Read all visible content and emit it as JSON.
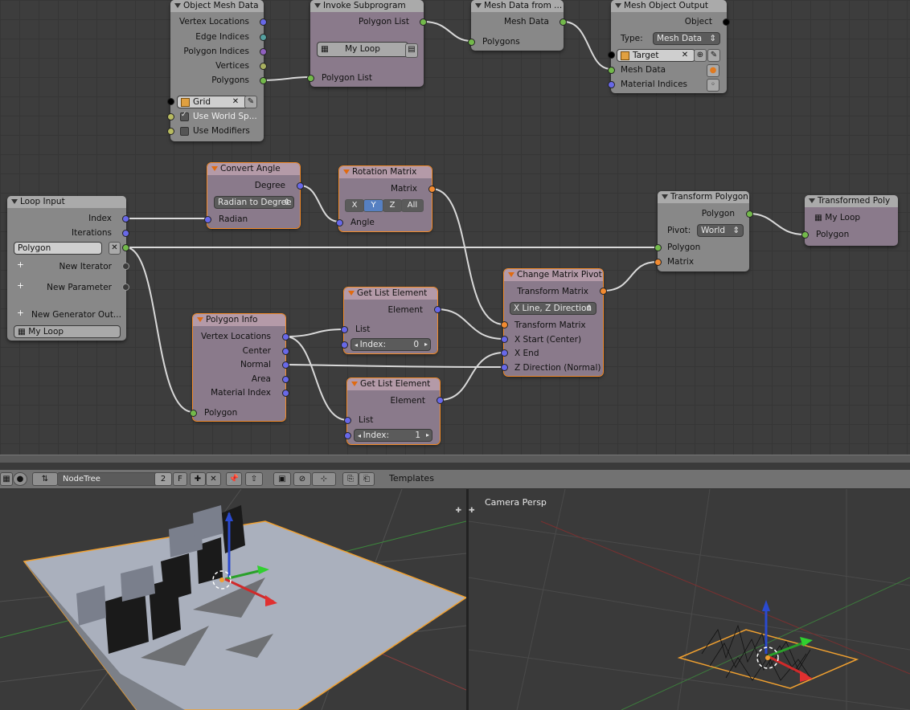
{
  "nodes": {
    "object_mesh_data": {
      "title": "Object Mesh Data",
      "outputs": [
        "Vertex Locations",
        "Edge Indices",
        "Polygon Indices",
        "Vertices",
        "Polygons"
      ],
      "object": "Grid",
      "use_world_space": "Use World Sp...",
      "use_modifiers": "Use Modifiers"
    },
    "invoke_subprogram": {
      "title": "Invoke Subprogram",
      "output": "Polygon List",
      "subprogram": "My Loop",
      "input": "Polygon List"
    },
    "mesh_data_from": {
      "title": "Mesh Data from ...",
      "output": "Mesh Data",
      "input": "Polygons"
    },
    "mesh_object_output": {
      "title": "Mesh Object Output",
      "output": "Object",
      "type_label": "Type:",
      "type_value": "Mesh Data",
      "target": "Target",
      "inputs": [
        "Mesh Data",
        "Material Indices"
      ]
    },
    "loop_input": {
      "title": "Loop Input",
      "outputs": [
        "Index",
        "Iterations"
      ],
      "polygon_param": "Polygon",
      "new_iterator": "New Iterator",
      "new_parameter": "New Parameter",
      "new_generator": "New Generator Out...",
      "loop_name": "My Loop"
    },
    "convert_angle": {
      "title": "Convert Angle",
      "output": "Degree",
      "mode": "Radian to Degree",
      "input": "Radian"
    },
    "rotation_matrix": {
      "title": "Rotation Matrix",
      "output": "Matrix",
      "axes": [
        "X",
        "Y",
        "Z",
        "All"
      ],
      "input": "Angle"
    },
    "transform_polygon": {
      "title": "Transform Polygon",
      "output": "Polygon",
      "pivot_label": "Pivot:",
      "pivot_value": "World",
      "inputs": [
        "Polygon",
        "Matrix"
      ]
    },
    "transformed_poly": {
      "title": "Transformed Poly",
      "loop_name": "My Loop",
      "input": "Polygon"
    },
    "change_matrix_pivot": {
      "title": "Change Matrix Pivot",
      "output": "Transform Matrix",
      "mode": "X Line, Z Direction",
      "inputs": [
        "Transform Matrix",
        "X Start (Center)",
        "X End",
        "Z Direction (Normal)"
      ]
    },
    "get_list_element_1": {
      "title": "Get List Element",
      "output": "Element",
      "input": "List",
      "index_label": "Index:",
      "index_value": "0"
    },
    "get_list_element_2": {
      "title": "Get List Element",
      "output": "Element",
      "input": "List",
      "index_label": "Index:",
      "index_value": "1"
    },
    "polygon_info": {
      "title": "Polygon Info",
      "outputs": [
        "Vertex Locations",
        "Center",
        "Normal",
        "Area",
        "Material Index"
      ],
      "input": "Polygon"
    }
  },
  "toolbar": {
    "tree_name": "NodeTree",
    "users": "2",
    "fake_user": "F",
    "templates": "Templates"
  },
  "viewport_right": {
    "label": "Camera Persp"
  },
  "colors": {
    "node_selected_outline": "#f28a28",
    "node_body": "#8a7a8b",
    "link": "#d8d8d8",
    "background": "#3d3d3d"
  }
}
